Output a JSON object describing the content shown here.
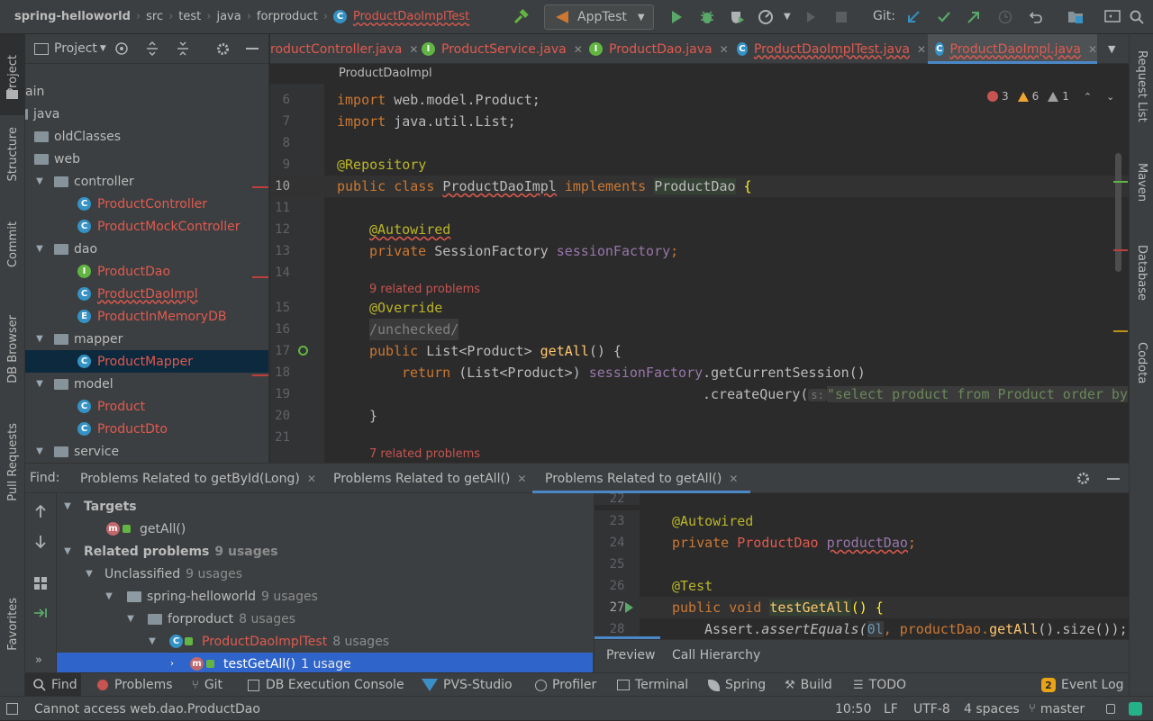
{
  "titlebar": {
    "breadcrumbs": [
      "spring-helloworld",
      "src",
      "test",
      "java",
      "forproduct",
      "ProductDaoImplTest"
    ],
    "run_config": "AppTest",
    "git_label": "Git:"
  },
  "left_tools": [
    "Project",
    "Structure",
    "Commit",
    "DB Browser",
    "Pull Requests",
    "Favorites"
  ],
  "right_tools": [
    "Request List",
    "Maven",
    "Database",
    "Codota"
  ],
  "project": {
    "header": "Project",
    "tree": [
      {
        "label": "ain",
        "type": "text"
      },
      {
        "label": "java",
        "type": "folder"
      },
      {
        "label": "oldClasses",
        "type": "folder"
      },
      {
        "label": "web",
        "type": "folder"
      },
      {
        "label": "controller",
        "type": "folder"
      },
      {
        "label": "ProductController",
        "type": "class"
      },
      {
        "label": "ProductMockController",
        "type": "class"
      },
      {
        "label": "dao",
        "type": "folder"
      },
      {
        "label": "ProductDao",
        "type": "interface"
      },
      {
        "label": "ProductDaoImpl",
        "type": "class"
      },
      {
        "label": "ProductInMemoryDB",
        "type": "enum"
      },
      {
        "label": "mapper",
        "type": "folder"
      },
      {
        "label": "ProductMapper",
        "type": "class"
      },
      {
        "label": "model",
        "type": "folder"
      },
      {
        "label": "Product",
        "type": "class"
      },
      {
        "label": "ProductDto",
        "type": "class"
      },
      {
        "label": "service",
        "type": "folder"
      }
    ]
  },
  "editor": {
    "tabs": [
      "roductController.java",
      "ProductService.java",
      "ProductDao.java",
      "ProductDaoImplTest.java",
      "ProductDaoImpl.java"
    ],
    "breadcrumb": "ProductDaoImpl",
    "inspection": {
      "errors": "3",
      "warnings": "6",
      "weak": "1"
    },
    "line_numbers": [
      "6",
      "7",
      "8",
      "9",
      "10",
      "11",
      "12",
      "13",
      "14",
      "15",
      "16",
      "17",
      "18",
      "19",
      "20",
      "21"
    ],
    "code": {
      "l6a": "import ",
      "l6b": "web.model.Product;",
      "l7a": "import ",
      "l7b": "java.util.List;",
      "l9": "@Repository",
      "l10a": "public class ",
      "l10b": "ProductDaoImpl",
      "l10c": " implements ",
      "l10d": "ProductDao",
      "l10e": " {",
      "l12": "@Autowired",
      "l13a": "private ",
      "l13b": "SessionFactory ",
      "l13c": "sessionFactory",
      "l13d": ";",
      "rel1": "9 related problems",
      "l15": "@Override",
      "l16": "/unchecked/",
      "l17a": "public ",
      "l17b": "List<Product> ",
      "l17c": "getAll",
      "l17d": "() {",
      "l18a": "return ",
      "l18b": "(List<Product>) ",
      "l18c": "sessionFactory",
      "l18d": ".getCurrentSession()",
      "l19a": ".createQuery(",
      "l19hint": "s:",
      "l19b": "\"select product from Product order by",
      "l20": "}",
      "rel2": "7 related problems"
    }
  },
  "find": {
    "label": "Find:",
    "tabs": [
      "Problems Related to getById(Long)",
      "Problems Related to getAll()",
      "Problems Related to getAll()"
    ],
    "tree": {
      "targets": "Targets",
      "target_item": "getAll()",
      "related": "Related problems",
      "related_count": "9 usages",
      "unclassified": "Unclassified",
      "unclassified_count": "9 usages",
      "module": "spring-helloworld",
      "module_count": "9 usages",
      "package": "forproduct",
      "package_count": "8 usages",
      "class": "ProductDaoImplTest",
      "class_count": "8 usages",
      "method": "testGetAll()",
      "method_count": "1 usage"
    },
    "preview": {
      "line_numbers": [
        "22",
        "23",
        "24",
        "25",
        "26",
        "27",
        "28"
      ],
      "p23": "@Autowired",
      "p24a": "private ",
      "p24b": "ProductDao ",
      "p24c": "productDao",
      "p24d": ";",
      "p26": "@Test",
      "p27a": "public void ",
      "p27b": "testGetAll",
      "p27c": "() {",
      "p28a": "Assert.",
      "p28b": "assertEquals(",
      "p28c": "0l",
      "p28d": ", productDao.",
      "p28e": "getAll",
      "p28f": "().size());",
      "tabs": [
        "Preview",
        "Call Hierarchy"
      ]
    }
  },
  "bottom_tools": [
    "Find",
    "Problems",
    "Git",
    "DB Execution Console",
    "PVS-Studio",
    "Profiler",
    "Terminal",
    "Spring",
    "Build",
    "TODO",
    "Event Log"
  ],
  "event_log_count": "2",
  "status": {
    "message": "Cannot access web.dao.ProductDao",
    "position": "10:50",
    "line_sep": "LF",
    "encoding": "UTF-8",
    "indent": "4 spaces",
    "branch": "master"
  },
  "colors": {
    "accent": "#4a88c7",
    "error": "#e05a4f",
    "selection": "#2f65ca",
    "keyword": "#cc7832",
    "annotation": "#bbb529",
    "field": "#9876aa",
    "method": "#ffc66d",
    "string": "#6a8759"
  }
}
